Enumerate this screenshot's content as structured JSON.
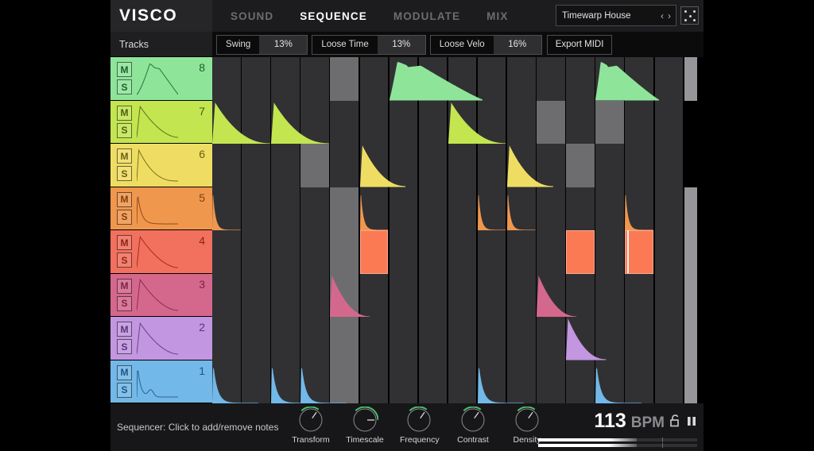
{
  "app": {
    "logo": "VISCO"
  },
  "nav": {
    "tabs": [
      {
        "label": "SOUND",
        "active": false
      },
      {
        "label": "SEQUENCE",
        "active": true
      },
      {
        "label": "MODULATE",
        "active": false
      },
      {
        "label": "MIX",
        "active": false
      }
    ]
  },
  "preset": {
    "name": "Timewarp House",
    "prev": "‹",
    "next": "›",
    "randomize_icon": "dice-icon"
  },
  "toolbar": {
    "tracks_label": "Tracks",
    "groups": [
      {
        "label": "Swing",
        "value": "13%"
      },
      {
        "label": "Loose Time",
        "value": "13%"
      },
      {
        "label": "Loose Velo",
        "value": "16%"
      }
    ],
    "export_label": "Export MIDI"
  },
  "sequencer": {
    "mute_label": "M",
    "solo_label": "S",
    "columns": 16,
    "tracks": [
      {
        "number": "8",
        "color": "#8ee59a",
        "ink": "#1d5d2c",
        "envelope": "slow-attack-peak",
        "notes": [
          {
            "col": 7,
            "len": 3.2,
            "shape": "swell"
          },
          {
            "col": 14,
            "len": 2.2,
            "shape": "swell"
          }
        ],
        "accents": [
          5
        ],
        "last_step": true
      },
      {
        "number": "7",
        "color": "#c3e550",
        "ink": "#4c5d13",
        "envelope": "medium-decay",
        "notes": [
          {
            "col": 1,
            "len": 2.0,
            "shape": "decay"
          },
          {
            "col": 3,
            "len": 2.0,
            "shape": "decay"
          },
          {
            "col": 9,
            "len": 2.0,
            "shape": "decay"
          }
        ],
        "accents": [
          12,
          14
        ],
        "last_step": false
      },
      {
        "number": "6",
        "color": "#efdd63",
        "ink": "#6a5d12",
        "envelope": "fast-decay",
        "notes": [
          {
            "col": 6,
            "len": 1.6,
            "shape": "decay"
          },
          {
            "col": 11,
            "len": 1.6,
            "shape": "decay"
          }
        ],
        "accents": [
          4,
          13
        ],
        "last_step": false
      },
      {
        "number": "5",
        "color": "#f0974e",
        "ink": "#7d3f0c",
        "envelope": "pluck",
        "notes": [
          {
            "col": 1,
            "len": 1.0,
            "shape": "pluck"
          },
          {
            "col": 6,
            "len": 1.0,
            "shape": "pluck"
          },
          {
            "col": 10,
            "len": 1.0,
            "shape": "pluck"
          },
          {
            "col": 11,
            "len": 1.0,
            "shape": "pluck"
          },
          {
            "col": 15,
            "len": 1.0,
            "shape": "pluck"
          }
        ],
        "accents": [
          5
        ],
        "last_step": true
      },
      {
        "number": "4",
        "color": "#f2705e",
        "ink": "#8a2418",
        "envelope": "medium-decay",
        "notes": [],
        "selected": [
          6,
          13,
          15
        ],
        "accents": [
          5
        ],
        "playhead_col": 15,
        "last_step": true
      },
      {
        "number": "3",
        "color": "#d4688c",
        "ink": "#7a2545",
        "envelope": "medium-decay",
        "notes": [
          {
            "col": 5,
            "len": 1.4,
            "shape": "decay"
          },
          {
            "col": 12,
            "len": 1.4,
            "shape": "decay"
          }
        ],
        "accents": [
          5
        ],
        "last_step": true
      },
      {
        "number": "2",
        "color": "#c296e0",
        "ink": "#5c3379",
        "envelope": "medium-decay",
        "notes": [
          {
            "col": 13,
            "len": 1.4,
            "shape": "decay"
          }
        ],
        "accents": [
          5
        ],
        "last_step": true
      },
      {
        "number": "1",
        "color": "#72b8e8",
        "ink": "#1d5580",
        "envelope": "double-pluck",
        "notes": [
          {
            "col": 1,
            "len": 1.6,
            "shape": "pluck"
          },
          {
            "col": 3,
            "len": 1.6,
            "shape": "pluck"
          },
          {
            "col": 4,
            "len": 1.6,
            "shape": "pluck"
          },
          {
            "col": 10,
            "len": 1.6,
            "shape": "pluck"
          },
          {
            "col": 14,
            "len": 1.6,
            "shape": "pluck"
          }
        ],
        "accents": [
          5
        ],
        "last_step": true
      }
    ]
  },
  "footer": {
    "hint": "Sequencer: Click to add/remove notes",
    "knobs": [
      {
        "label": "Transform",
        "value": 0.3
      },
      {
        "label": "Timescale",
        "value": 0.5
      },
      {
        "label": "Frequency",
        "value": 0.3
      },
      {
        "label": "Contrast",
        "value": 0.3
      },
      {
        "label": "Density",
        "value": 0.3
      }
    ],
    "knob_accent": "#4cc06a",
    "bpm": "113",
    "bpm_unit": "BPM",
    "lock_icon": "unlocked-padlock-icon",
    "transport_icon": "pause-icon",
    "meters": [
      {
        "fill": 0.62
      },
      {
        "fill": 0.62
      }
    ]
  }
}
